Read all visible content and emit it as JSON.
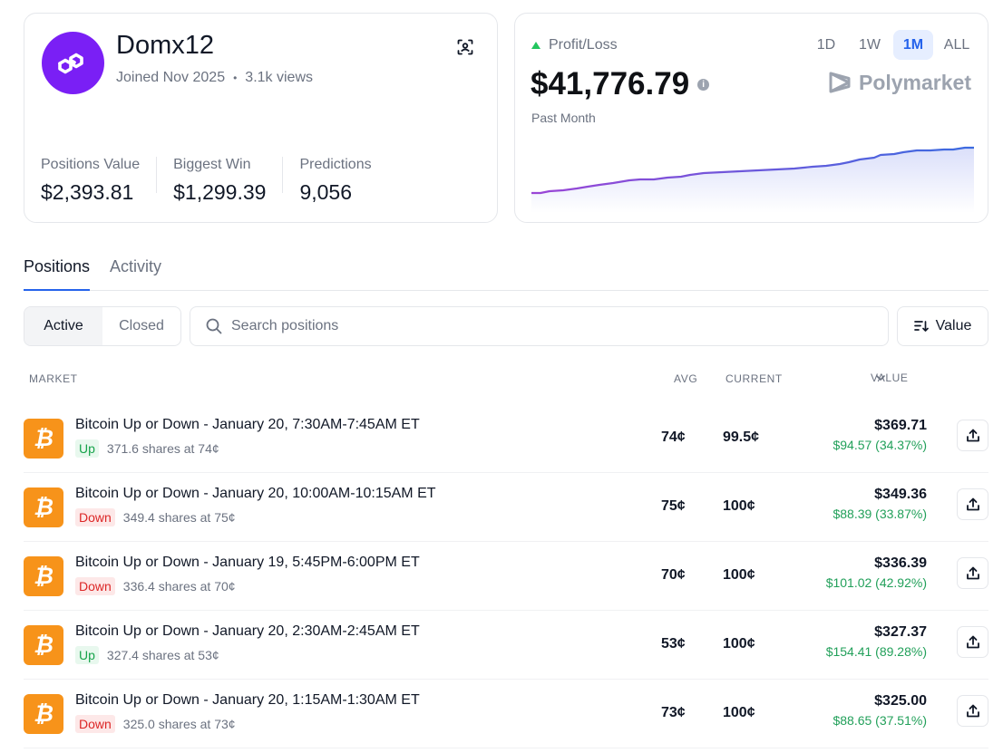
{
  "profile": {
    "username": "Domx12",
    "joined": "Joined Nov 2025",
    "views": "3.1k views",
    "stats": [
      {
        "label": "Positions Value",
        "value": "$2,393.81"
      },
      {
        "label": "Biggest Win",
        "value": "$1,299.39"
      },
      {
        "label": "Predictions",
        "value": "9,056"
      }
    ]
  },
  "pnl": {
    "label": "Profit/Loss",
    "value": "$41,776.79",
    "period": "Past Month",
    "brand": "Polymarket",
    "ranges": [
      "1D",
      "1W",
      "1M",
      "ALL"
    ],
    "active_range": "1M",
    "colors": {
      "line": "#5a4bdc",
      "up": "#22c55e"
    }
  },
  "tabs": [
    {
      "label": "Positions",
      "active": true
    },
    {
      "label": "Activity",
      "active": false
    }
  ],
  "filters": {
    "active_label": "Active",
    "closed_label": "Closed",
    "search_placeholder": "Search positions",
    "sort_label": "Value"
  },
  "table": {
    "headers": {
      "market": "MARKET",
      "avg": "AVG",
      "current": "CURRENT",
      "value": "VALUE"
    },
    "rows": [
      {
        "title": "Bitcoin Up or Down - January 20, 7:30AM-7:45AM ET",
        "side": "Up",
        "shares": "371.6 shares at 74¢",
        "avg": "74¢",
        "current": "99.5¢",
        "value": "$369.71",
        "gain": "$94.57 (34.37%)"
      },
      {
        "title": "Bitcoin Up or Down - January 20, 10:00AM-10:15AM ET",
        "side": "Down",
        "shares": "349.4 shares at 75¢",
        "avg": "75¢",
        "current": "100¢",
        "value": "$349.36",
        "gain": "$88.39 (33.87%)"
      },
      {
        "title": "Bitcoin Up or Down - January 19, 5:45PM-6:00PM ET",
        "side": "Down",
        "shares": "336.4 shares at 70¢",
        "avg": "70¢",
        "current": "100¢",
        "value": "$336.39",
        "gain": "$101.02 (42.92%)"
      },
      {
        "title": "Bitcoin Up or Down - January 20, 2:30AM-2:45AM ET",
        "side": "Up",
        "shares": "327.4 shares at 53¢",
        "avg": "53¢",
        "current": "100¢",
        "value": "$327.37",
        "gain": "$154.41 (89.28%)"
      },
      {
        "title": "Bitcoin Up or Down - January 20, 1:15AM-1:30AM ET",
        "side": "Down",
        "shares": "325.0 shares at 73¢",
        "avg": "73¢",
        "current": "100¢",
        "value": "$325.00",
        "gain": "$88.65 (37.51%)"
      }
    ]
  }
}
